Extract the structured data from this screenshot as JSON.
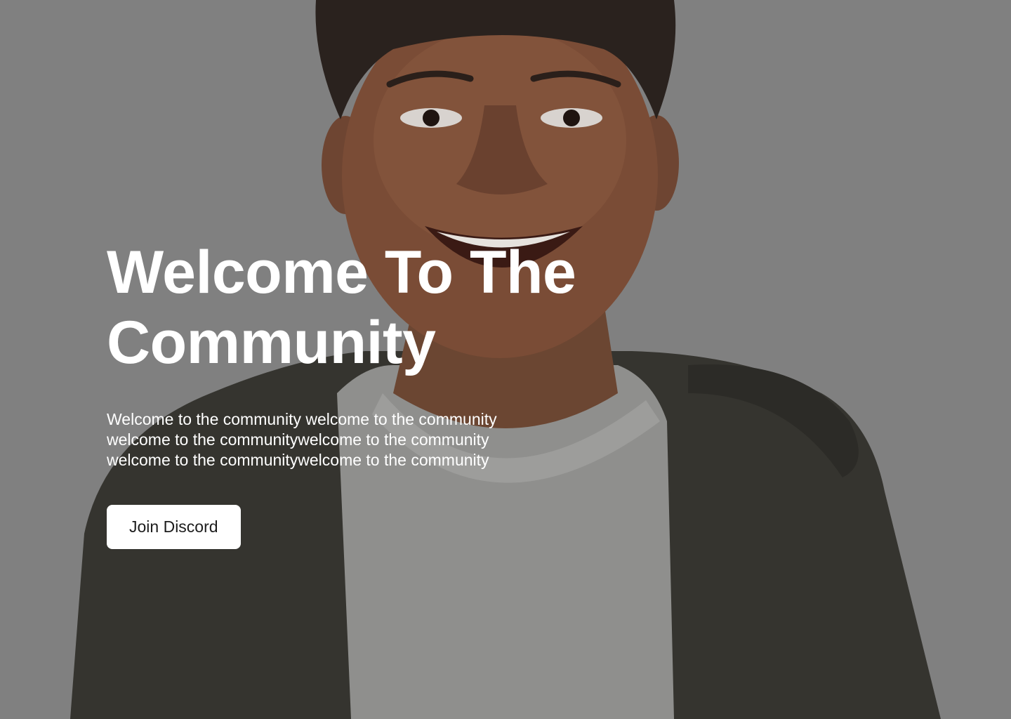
{
  "hero": {
    "title_line1": "Welcome To The",
    "title_line2": "Community",
    "description_line1": "Welcome to the community welcome to the community",
    "description_line2": "welcome to the communitywelcome to the community",
    "description_line3": "welcome to the communitywelcome to the community",
    "cta_label": "Join Discord"
  },
  "colors": {
    "overlay": "#808080",
    "text": "#ffffff",
    "button_bg": "#ffffff",
    "button_text": "#1c1c1c"
  }
}
